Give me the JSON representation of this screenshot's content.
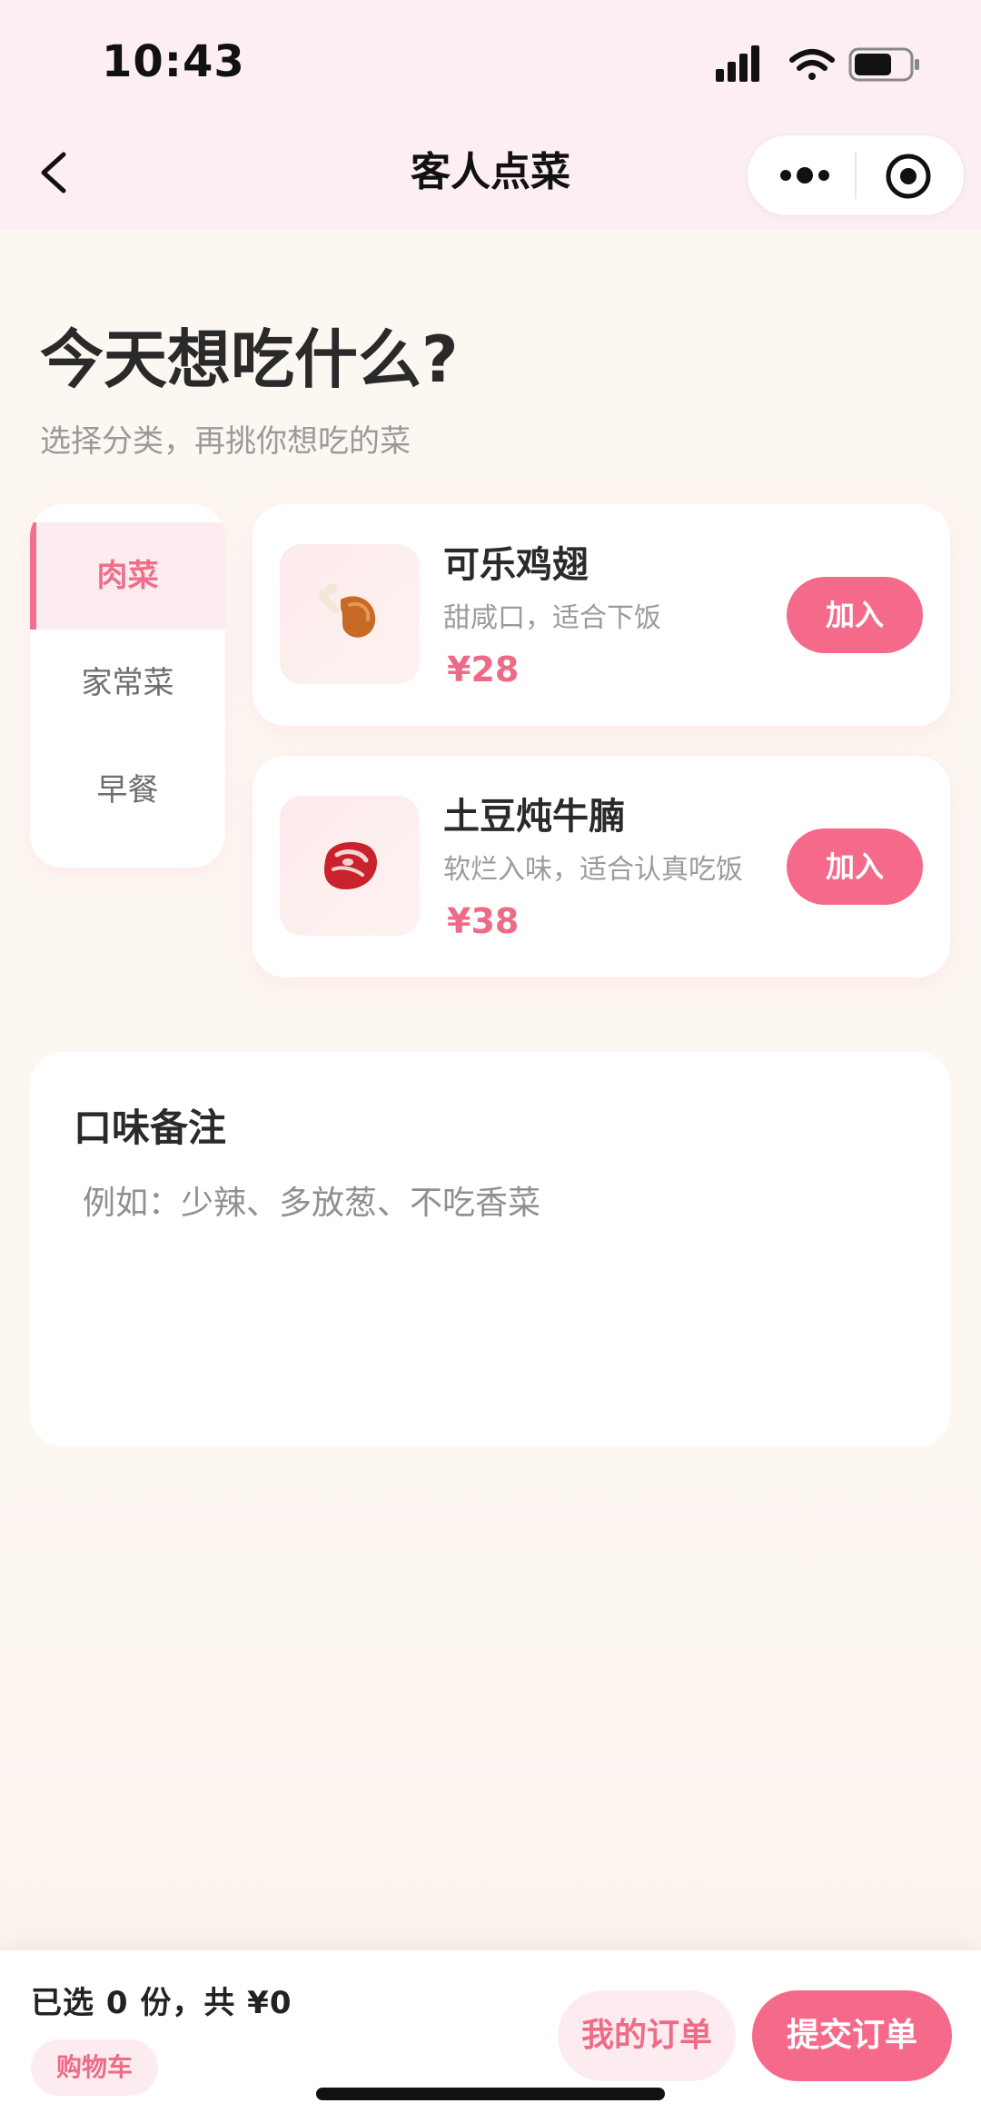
{
  "status_bar": {
    "time": "10:43"
  },
  "nav": {
    "title": "客人点菜"
  },
  "hero": {
    "title": "今天想吃什么?",
    "subtitle": "选择分类，再挑你想吃的菜"
  },
  "categories": [
    {
      "label": "肉菜",
      "active": true
    },
    {
      "label": "家常菜",
      "active": false
    },
    {
      "label": "早餐",
      "active": false
    }
  ],
  "dishes": [
    {
      "name": "可乐鸡翅",
      "desc": "甜咸口，适合下饭",
      "price": "¥28",
      "icon": "poultry-leg-icon",
      "add_label": "加入"
    },
    {
      "name": "土豆炖牛腩",
      "desc": "软烂入味，适合认真吃饭",
      "price": "¥38",
      "icon": "steak-icon",
      "add_label": "加入"
    }
  ],
  "notes": {
    "title": "口味备注",
    "placeholder": "例如：少辣、多放葱、不吃香菜",
    "value": ""
  },
  "bottom": {
    "summary": "已选 0 份，共 ¥0",
    "cart_label": "购物车",
    "orders_label": "我的订单",
    "submit_label": "提交订单"
  },
  "colors": {
    "accent": "#f56a8a",
    "accent_text": "#ee6b87",
    "accent_bg": "#fdecef",
    "header_bg": "#fdeff1"
  }
}
